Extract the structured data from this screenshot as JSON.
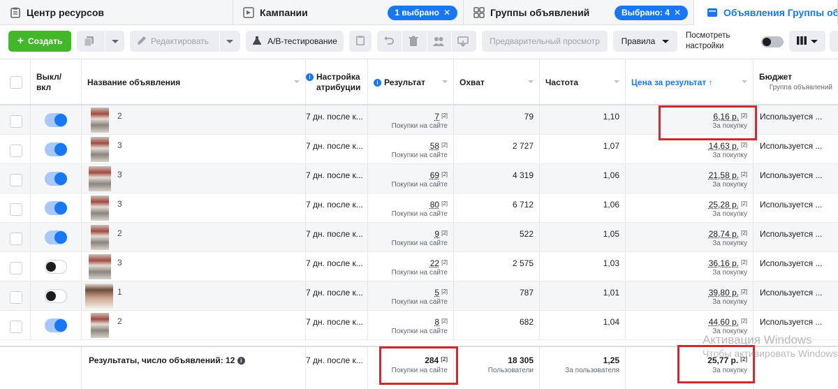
{
  "tabs": [
    {
      "label": "Центр ресурсов",
      "icon": "clipboard-icon",
      "active": false
    },
    {
      "label": "Кампании",
      "icon": "campaign-icon",
      "active": false,
      "badge": "1 выбрано"
    },
    {
      "label": "Группы объявлений",
      "icon": "grid-icon",
      "active": false,
      "badge": "Выбрано: 4"
    },
    {
      "label": "Объявления Группы объ",
      "icon": "ad-icon",
      "active": true
    }
  ],
  "toolbar": {
    "create": "Создать",
    "edit": "Редактировать",
    "ab_test": "A/B-тестирование",
    "preview": "Предварительный просмотр",
    "rules": "Правила",
    "view_settings": "Посмотреть настройки"
  },
  "columns": {
    "toggle": "Выкл/вкл",
    "name": "Название объявления",
    "attribution": "Настройка атрибуции",
    "result": "Результат",
    "reach": "Охват",
    "frequency": "Частота",
    "cost_per_result": "Цена за результат",
    "budget": "Бюджет",
    "budget_sub": "Группа объявлений"
  },
  "rows": [
    {
      "on": true,
      "name": "2",
      "attribution": "7 дн. после к...",
      "result": "7",
      "result_sub": "Покупки на сайте",
      "reach": "79",
      "frequency": "1,10",
      "cost": "6,16 р.",
      "cost_sub": "За покупку",
      "budget": "Используется ..."
    },
    {
      "on": true,
      "name": "3",
      "attribution": "7 дн. после к...",
      "result": "58",
      "result_sub": "Покупки на сайте",
      "reach": "2 727",
      "frequency": "1,07",
      "cost": "14,63 р.",
      "cost_sub": "За покупку",
      "budget": "Используется ..."
    },
    {
      "on": true,
      "name": "3",
      "attribution": "7 дн. после к...",
      "result": "69",
      "result_sub": "Покупки на сайте",
      "reach": "4 319",
      "frequency": "1,06",
      "cost": "21,58 р.",
      "cost_sub": "За покупку",
      "budget": "Используется ..."
    },
    {
      "on": true,
      "name": "3",
      "attribution": "7 дн. после к...",
      "result": "80",
      "result_sub": "Покупки на сайте",
      "reach": "6 712",
      "frequency": "1,06",
      "cost": "25,28 р.",
      "cost_sub": "За покупку",
      "budget": "Используется ..."
    },
    {
      "on": true,
      "name": "2",
      "attribution": "7 дн. после к...",
      "result": "9",
      "result_sub": "Покупки на сайте",
      "reach": "522",
      "frequency": "1,05",
      "cost": "28,74 р.",
      "cost_sub": "За покупку",
      "budget": "Используется ..."
    },
    {
      "on": false,
      "name": "3",
      "attribution": "7 дн. после к...",
      "result": "22",
      "result_sub": "Покупки на сайте",
      "reach": "2 575",
      "frequency": "1,03",
      "cost": "36,16 р.",
      "cost_sub": "За покупку",
      "budget": "Используется ..."
    },
    {
      "on": false,
      "name": "1",
      "attribution": "7 дн. после к...",
      "result": "5",
      "result_sub": "Покупки на сайте",
      "reach": "787",
      "frequency": "1,01",
      "cost": "39,80 р.",
      "cost_sub": "За покупку",
      "budget": "Используется ..."
    },
    {
      "on": true,
      "name": "2",
      "attribution": "7 дн. после к...",
      "result": "8",
      "result_sub": "Покупки на сайте",
      "reach": "682",
      "frequency": "1,04",
      "cost": "44,60 р.",
      "cost_sub": "За покупку",
      "budget": "Используется ..."
    }
  ],
  "totals": {
    "label": "Результаты, число объявлений: 12",
    "attribution": "7 дн. после к...",
    "result": "284",
    "result_sub": "Покупки на сайте",
    "reach": "18 305",
    "reach_sub": "Пользователи",
    "frequency": "1,25",
    "frequency_sub": "За пользователя",
    "cost": "25,77 р.",
    "cost_sub": "За покупку"
  },
  "watermark": {
    "line1": "Активация Windows",
    "line2": "Чтобы активировать Windows, перейдите в раздел \"Параметры\"."
  },
  "colors": {
    "accent": "#1877f2",
    "create_green": "#42b72a",
    "highlight_red": "#cc2a2f"
  }
}
